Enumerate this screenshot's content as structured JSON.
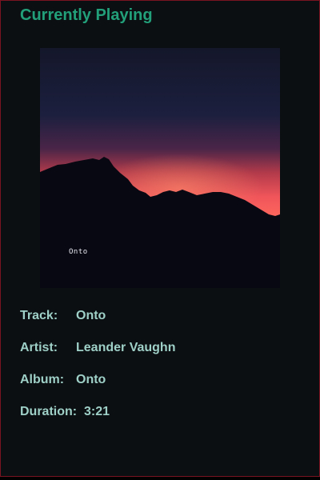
{
  "title": "Currently Playing",
  "cover": {
    "caption": "Onto"
  },
  "info": {
    "track_label": "Track:",
    "track_value": "Onto",
    "artist_label": "Artist:",
    "artist_value": "Leander Vaughn",
    "album_label": "Album:",
    "album_value": "Onto",
    "duration_label": "Duration:",
    "duration_value": "3:21"
  },
  "colors": {
    "background": "#0c0f11",
    "border": "#7a1420",
    "title": "#22a07a",
    "info_text": "#9fd0c8"
  }
}
